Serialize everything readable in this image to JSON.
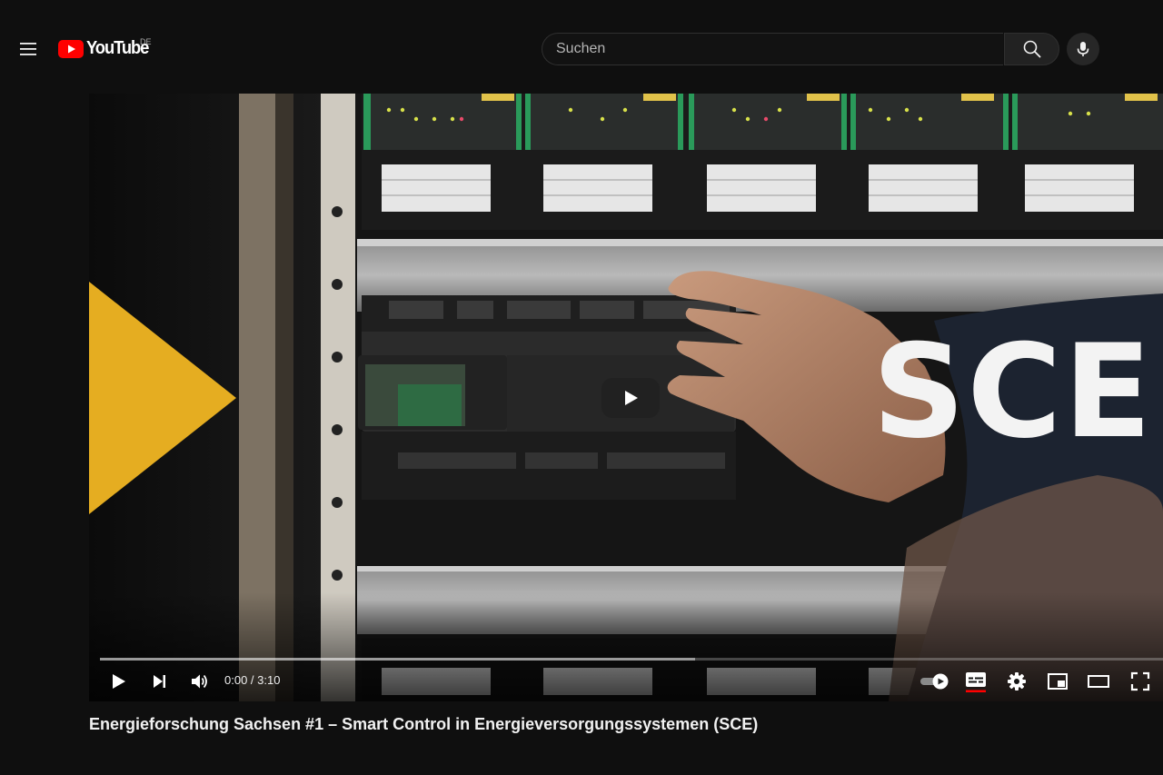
{
  "header": {
    "logo_text": "YouTube",
    "country_code": "DE",
    "search_placeholder": "Suchen"
  },
  "player": {
    "overlay_text": "SCE",
    "time_display": "0:00 / 3:10",
    "buffered_fraction": 0.56,
    "played_fraction": 0.0
  },
  "video": {
    "title": "Energieforschung Sachsen #1 – Smart Control in Energieversorgungssystemen (SCE)"
  },
  "colors": {
    "brand_red": "#ff0000",
    "background": "#0f0f0f",
    "accent_yellow": "#e5ad21"
  },
  "icons": [
    "menu-icon",
    "youtube-logo-icon",
    "search-icon",
    "mic-icon",
    "play-icon",
    "next-icon",
    "volume-icon",
    "autoplay-toggle",
    "subtitles-icon",
    "settings-icon",
    "miniplayer-icon",
    "theater-icon",
    "fullscreen-icon"
  ]
}
